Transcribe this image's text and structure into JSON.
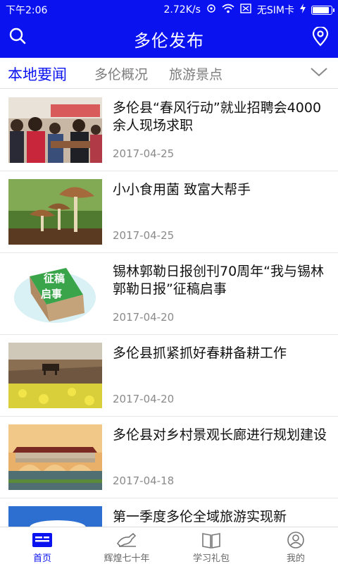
{
  "status_bar": {
    "time": "下午2:06",
    "speed": "2.72K/s",
    "sim": "无SIM卡",
    "battery_level": 0.95
  },
  "app_bar": {
    "title": "多伦发布",
    "search_icon": "search-icon",
    "location_icon": "location-pin-icon"
  },
  "tabs": [
    {
      "label": "本地要闻",
      "active": true
    },
    {
      "label": "多伦概况",
      "active": false
    },
    {
      "label": "旅游景点",
      "active": false
    }
  ],
  "news": [
    {
      "title": "多伦县“春风行动”就业招聘会4000余人现场求职",
      "date": "2017-04-25"
    },
    {
      "title": "小小食用菌 致富大帮手",
      "date": "2017-04-25"
    },
    {
      "title": "锡林郭勒日报创刊70周年“我与锡林郭勒日报”征稿启事",
      "date": "2017-04-20",
      "thumb_text_1": "征稿",
      "thumb_text_2": "启事"
    },
    {
      "title": "多伦县抓紧抓好春耕备耕工作",
      "date": "2017-04-20"
    },
    {
      "title": "多伦县对乡村景观长廊进行规划建设",
      "date": "2017-04-18"
    },
    {
      "title": "第一季度多伦全域旅游实现新",
      "date": ""
    }
  ],
  "bottom_nav": [
    {
      "label": "首页",
      "icon": "home-news-icon",
      "active": true
    },
    {
      "label": "辉煌七十年",
      "icon": "horse-icon",
      "active": false
    },
    {
      "label": "学习礼包",
      "icon": "book-icon",
      "active": false
    },
    {
      "label": "我的",
      "icon": "user-icon",
      "active": false
    }
  ],
  "colors": {
    "brand": "#0a12f0",
    "date": "#8a8a8a",
    "inactive_tab": "#7d7d7d"
  }
}
